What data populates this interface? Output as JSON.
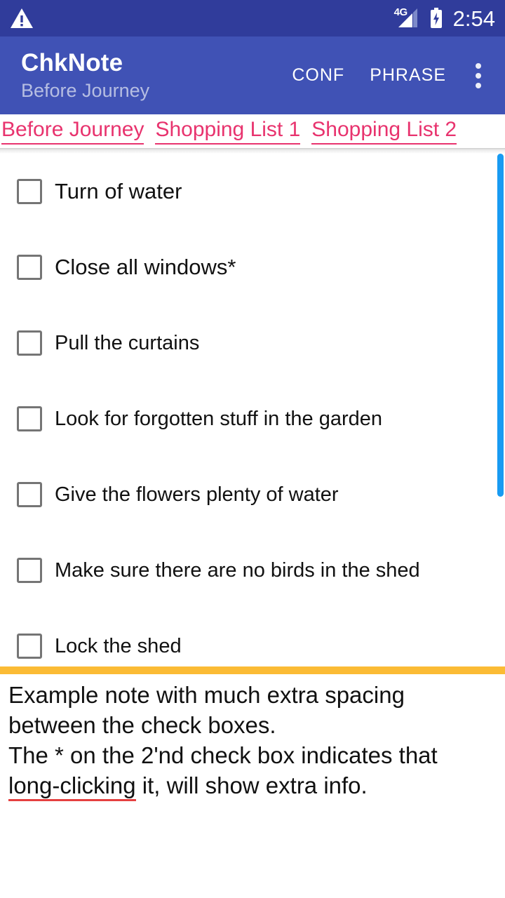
{
  "status_bar": {
    "warning_icon": "warning-triangle-icon",
    "network_label": "4G",
    "signal_icon": "signal-bars-icon",
    "battery_icon": "battery-charging-icon",
    "clock": "2:54",
    "background_color": "#303C9B"
  },
  "app_bar": {
    "title": "ChkNote",
    "subtitle": "Before Journey",
    "actions": [
      {
        "label": "CONF",
        "name": "conf-button"
      },
      {
        "label": "PHRASE",
        "name": "phrase-button"
      }
    ],
    "overflow_icon": "more-vertical-icon",
    "background_color": "#4052B5"
  },
  "tabs": {
    "accent_color": "#E8336E",
    "items": [
      {
        "label": "Before Journey",
        "selected": true
      },
      {
        "label": "Shopping List 1",
        "selected": false
      },
      {
        "label": "Shopping List 2",
        "selected": false
      }
    ]
  },
  "checklist": {
    "items": [
      {
        "label": "Turn of water",
        "checked": false,
        "size": "big"
      },
      {
        "label": "Close all windows*",
        "checked": false,
        "size": "big"
      },
      {
        "label": "Pull the curtains",
        "checked": false,
        "size": "normal"
      },
      {
        "label": "Look for forgotten stuff in the garden",
        "checked": false,
        "size": "normal"
      },
      {
        "label": "Give the flowers plenty of water",
        "checked": false,
        "size": "normal"
      },
      {
        "label": "Make sure there are no birds in the shed",
        "checked": false,
        "size": "normal"
      },
      {
        "label": "Lock the shed",
        "checked": false,
        "size": "normal"
      }
    ]
  },
  "scrollbar": {
    "color": "#189BF2",
    "thumb_position": "top"
  },
  "divider": {
    "color": "#FBBB35"
  },
  "note": {
    "line1": "Example note with much extra spacing",
    "line2": "between the check boxes.",
    "line3": "The * on the 2'nd check box indicates that",
    "line4_spelled": "long-clicking",
    "line4_rest": " it, will show extra info.",
    "spellcheck_color": "#E54040"
  }
}
